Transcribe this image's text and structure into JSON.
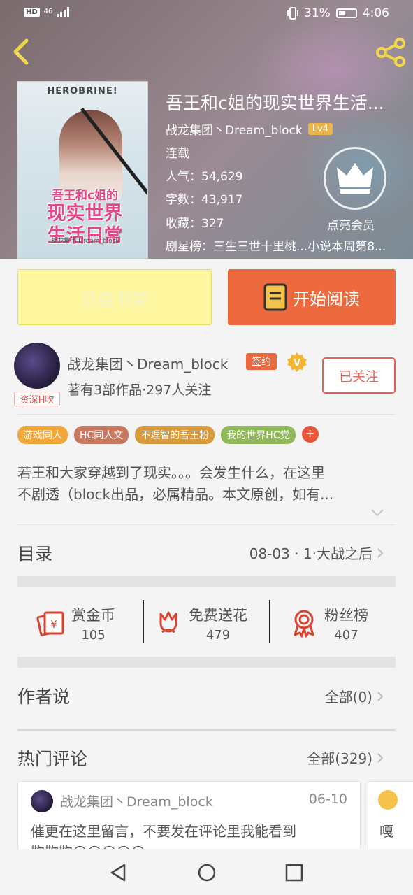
{
  "status_bar": {
    "left_badge": "HD",
    "network": "46",
    "battery": "31%",
    "time": "4:06"
  },
  "book": {
    "cover_top": "HEROBRINE!",
    "cover_title_line1": "吾王和c姐的",
    "cover_title_line2": "现实世界",
    "cover_title_line3": "生活日常",
    "cover_author": "战龙集团 Dream_block",
    "title": "吾王和c姐的现实世界生活...",
    "author": "战龙集团丶Dream_block",
    "level": "Lv4",
    "status": "连载",
    "popularity_label": "人气：",
    "popularity": "54,629",
    "word_count_label": "字数：",
    "word_count": "43,917",
    "favorites_label": "收藏：",
    "favorites": "327",
    "rank_label": "剧星榜：",
    "rank_text": "三生三世十里桃...小说本周第8...",
    "vip_label": "点亮会员"
  },
  "actions": {
    "shelf": "已在书架",
    "read": "开始阅读"
  },
  "author_row": {
    "name": "战龙集团丶Dream_block",
    "signed": "签约",
    "verified": "V",
    "meta": "著有3部作品·297人关注",
    "follow": "已关注",
    "avatar_tag": "资深H吹"
  },
  "tags": [
    {
      "label": "游戏同人",
      "color": "#f1a73a"
    },
    {
      "label": "HC同人文",
      "color": "#c8785f"
    },
    {
      "label": "不理智的吾王粉",
      "color": "#d99a3b"
    },
    {
      "label": "我的世界HC党",
      "color": "#8fb95a"
    }
  ],
  "tag_more": "+",
  "description": {
    "line1": "若王和大家穿越到了现实。。。会发生什么，在这里",
    "line2": "不剧透（block出品，必属精品。本文原创，如有..."
  },
  "catalog": {
    "title": "目录",
    "latest": "08-03 · 1·大战之后"
  },
  "stats": [
    {
      "label": "赏金币",
      "value": "105"
    },
    {
      "label": "免费送花",
      "value": "479"
    },
    {
      "label": "粉丝榜",
      "value": "407"
    }
  ],
  "author_says": {
    "title": "作者说",
    "all": "全部(0)"
  },
  "hot_comments": {
    "title": "热门评论",
    "all": "全部(329)",
    "items": [
      {
        "user": "战龙集团丶Dream_block",
        "date": "06-10",
        "text": "催更在这里留言，不要发在评论里我能看到",
        "text2": "鞠鞠鞠😊😊😊😊😊"
      }
    ],
    "peek_text": "嘎"
  },
  "colors": {
    "accent_orange": "#ec6a3e",
    "shelf_yellow": "#fff6a0",
    "follow_red": "#e46152"
  }
}
